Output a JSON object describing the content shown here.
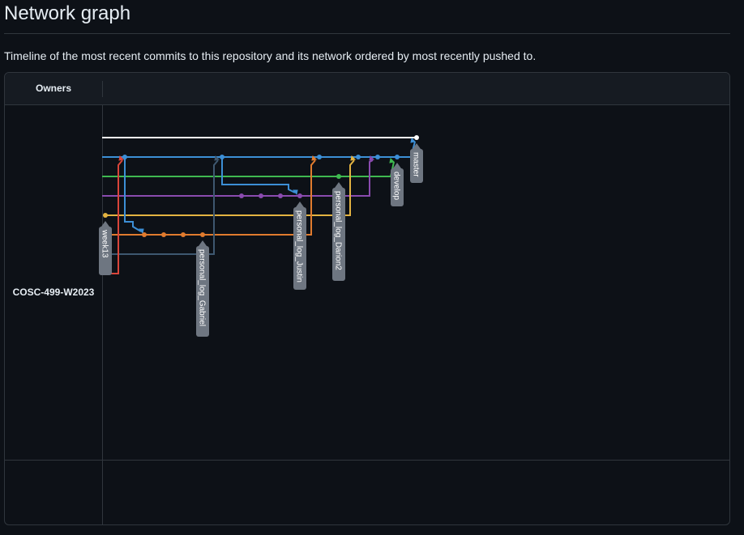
{
  "page": {
    "title": "Network graph",
    "subtitle": "Timeline of the most recent commits to this repository and its network ordered by most recently pushed to."
  },
  "panel": {
    "owners_header": "Owners",
    "owner": "COSC-499-W2023"
  },
  "colors": {
    "white": "#ffffff",
    "blue": "#3c8fd6",
    "green": "#3fb950",
    "purple": "#8a4baf",
    "yellow": "#e3b341",
    "orange": "#e07b2e",
    "slate": "#3e5870",
    "red": "#d9453a",
    "label_bg": "#6e7681"
  },
  "branches": [
    {
      "name": "master"
    },
    {
      "name": "develop"
    },
    {
      "name": "personal_log_Darion2"
    },
    {
      "name": "personal_log_Justin"
    },
    {
      "name": "personal_log_Gabriel"
    },
    {
      "name": "week13"
    }
  ]
}
